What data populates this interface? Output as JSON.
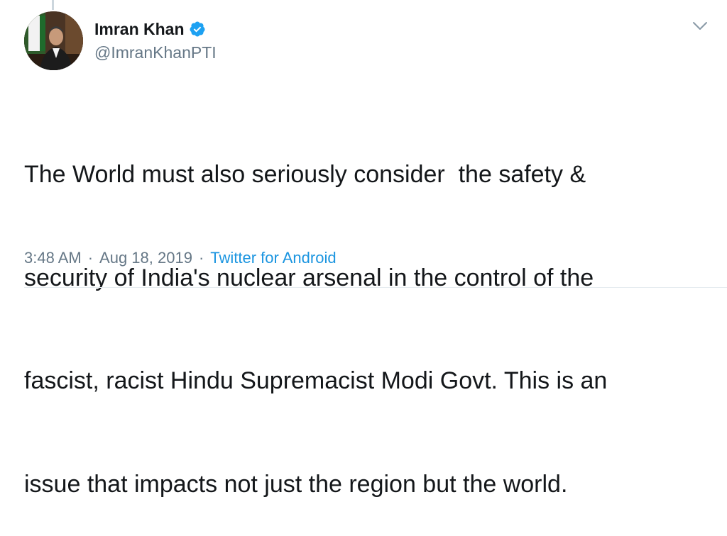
{
  "tweet": {
    "author": {
      "display_name": "Imran Khan",
      "handle": "@ImranKhanPTI",
      "verified_icon": "verified-badge-icon"
    },
    "text_lines": [
      "The World must also seriously consider  the safety &",
      "security of India's nuclear arsenal in the control of the",
      "fascist, racist Hindu Supremacist Modi Govt. This is an",
      "issue that impacts not just the region but the world."
    ],
    "time": "3:48 AM",
    "separator": "·",
    "date": "Aug 18, 2019",
    "source": "Twitter for Android",
    "menu_icon": "chevron-down-icon"
  },
  "colors": {
    "text": "#14171a",
    "secondary": "#657786",
    "link": "#1b95e0",
    "verified": "#1da1f2",
    "divider": "#e6ecf0"
  }
}
